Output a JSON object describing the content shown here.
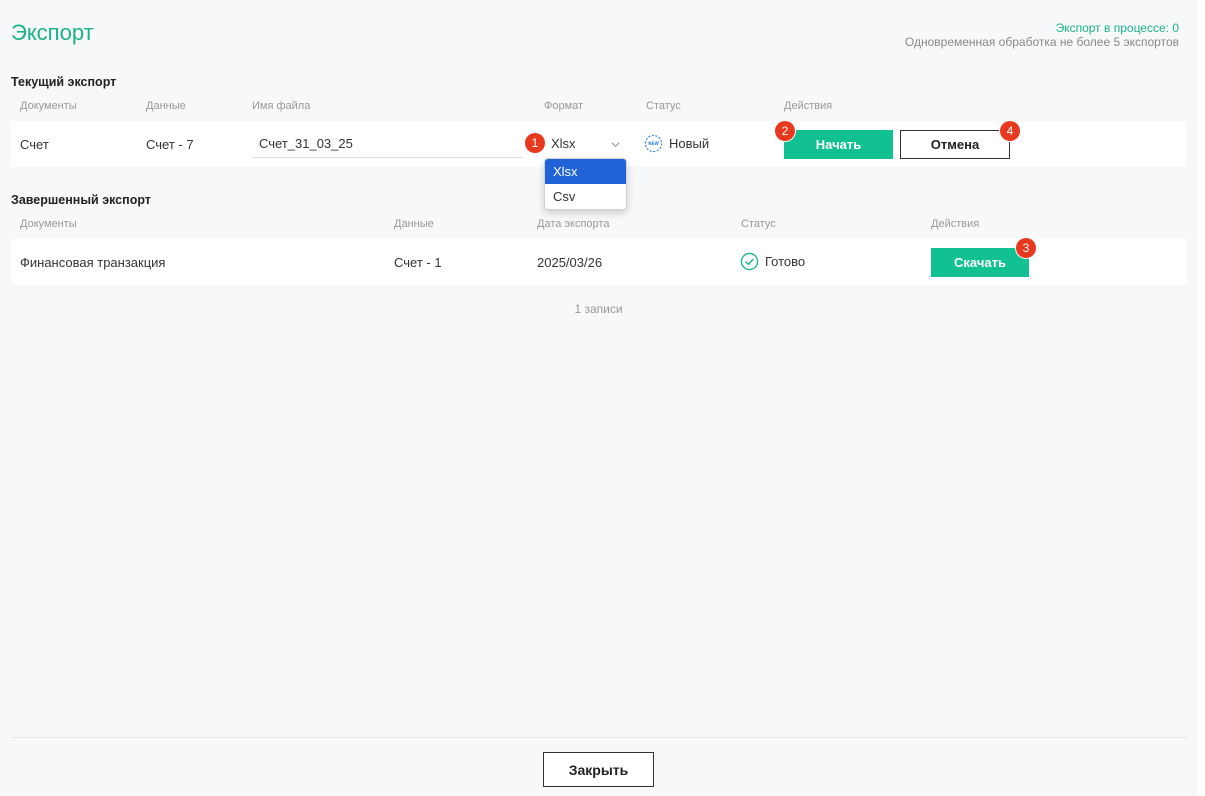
{
  "header": {
    "title": "Экспорт",
    "in_process": "Экспорт в процессе: 0",
    "limit": "Одновременная обработка не более 5 экспортов"
  },
  "current": {
    "section_title": "Текущий экспорт",
    "columns": [
      "Документы",
      "Данные",
      "Имя файла",
      "Формат",
      "Статус",
      "Действия"
    ],
    "row": {
      "document": "Счет",
      "data": "Счет - 7",
      "filename": "Счет_31_03_25",
      "format": "Xlsx",
      "status_icon": "new-badge-icon",
      "status": "Новый",
      "start_label": "Начать",
      "cancel_label": "Отмена"
    },
    "format_options": [
      "Xlsx",
      "Csv"
    ],
    "selected_option": "Xlsx"
  },
  "completed": {
    "section_title": "Завершенный экспорт",
    "columns": [
      "Документы",
      "Данные",
      "Дата экспорта",
      "Статус",
      "Действия"
    ],
    "rows": [
      {
        "document": "Финансовая транзакция",
        "data": "Счет - 1",
        "date": "2025/03/26",
        "status_icon": "check-circle-icon",
        "status": "Готово",
        "download_label": "Скачать"
      }
    ],
    "records": "1 записи"
  },
  "badges": [
    "1",
    "2",
    "3",
    "4"
  ],
  "footer": {
    "close_label": "Закрыть"
  },
  "colors": {
    "accent": "#1bb28a",
    "button": "#12c191",
    "badge": "#e8391f",
    "selected_option": "#1f63d6"
  }
}
